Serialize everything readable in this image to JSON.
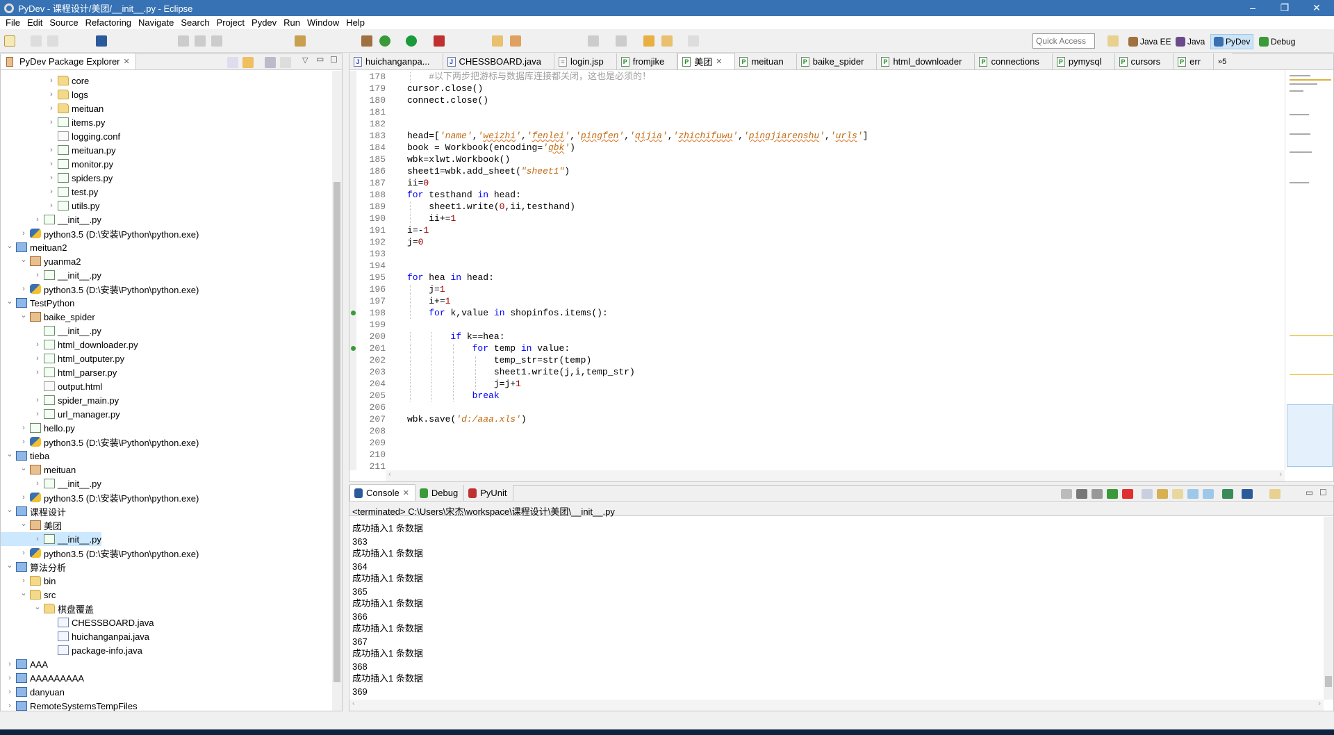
{
  "window": {
    "title": "PyDev - 课程设计/美团/__init__.py - Eclipse",
    "minimize": "–",
    "restore": "❐",
    "close": "✕"
  },
  "menu": [
    "File",
    "Edit",
    "Source",
    "Refactoring",
    "Navigate",
    "Search",
    "Project",
    "Pydev",
    "Run",
    "Window",
    "Help"
  ],
  "toolbar": {
    "quick_access_placeholder": "Quick Access",
    "perspectives": [
      {
        "label": "Java EE",
        "active": false
      },
      {
        "label": "Java",
        "active": false
      },
      {
        "label": "PyDev",
        "active": true
      },
      {
        "label": "Debug",
        "active": false
      }
    ]
  },
  "explorer": {
    "title": "PyDev Package Explorer",
    "items": [
      {
        "label": "core",
        "depth": 3,
        "arrow": ">",
        "icon": "folder"
      },
      {
        "label": "logs",
        "depth": 3,
        "arrow": ">",
        "icon": "folder"
      },
      {
        "label": "meituan",
        "depth": 3,
        "arrow": ">",
        "icon": "folder"
      },
      {
        "label": "items.py",
        "depth": 3,
        "arrow": ">",
        "icon": "pyfile"
      },
      {
        "label": "logging.conf",
        "depth": 3,
        "arrow": "",
        "icon": "txtfile"
      },
      {
        "label": "meituan.py",
        "depth": 3,
        "arrow": ">",
        "icon": "pyfile"
      },
      {
        "label": "monitor.py",
        "depth": 3,
        "arrow": ">",
        "icon": "pyfile"
      },
      {
        "label": "spiders.py",
        "depth": 3,
        "arrow": ">",
        "icon": "pyfile"
      },
      {
        "label": "test.py",
        "depth": 3,
        "arrow": ">",
        "icon": "pyfile"
      },
      {
        "label": "utils.py",
        "depth": 3,
        "arrow": ">",
        "icon": "pyfile"
      },
      {
        "label": "__init__.py",
        "depth": 2,
        "arrow": ">",
        "icon": "pyfile"
      },
      {
        "label": "python3.5  (D:\\安装\\Python\\python.exe)",
        "depth": 1,
        "arrow": ">",
        "icon": "python"
      },
      {
        "label": "meituan2",
        "depth": 0,
        "arrow": "v",
        "icon": "project"
      },
      {
        "label": "yuanma2",
        "depth": 1,
        "arrow": "v",
        "icon": "package"
      },
      {
        "label": "__init__.py",
        "depth": 2,
        "arrow": ">",
        "icon": "pyfile"
      },
      {
        "label": "python3.5  (D:\\安装\\Python\\python.exe)",
        "depth": 1,
        "arrow": ">",
        "icon": "python"
      },
      {
        "label": "TestPython",
        "depth": 0,
        "arrow": "v",
        "icon": "project"
      },
      {
        "label": "baike_spider",
        "depth": 1,
        "arrow": "v",
        "icon": "package"
      },
      {
        "label": "__init__.py",
        "depth": 2,
        "arrow": "",
        "icon": "pyfile"
      },
      {
        "label": "html_downloader.py",
        "depth": 2,
        "arrow": ">",
        "icon": "pyfile"
      },
      {
        "label": "html_outputer.py",
        "depth": 2,
        "arrow": ">",
        "icon": "pyfile"
      },
      {
        "label": "html_parser.py",
        "depth": 2,
        "arrow": ">",
        "icon": "pyfile"
      },
      {
        "label": "output.html",
        "depth": 2,
        "arrow": "",
        "icon": "txtfile"
      },
      {
        "label": "spider_main.py",
        "depth": 2,
        "arrow": ">",
        "icon": "pyfile"
      },
      {
        "label": "url_manager.py",
        "depth": 2,
        "arrow": ">",
        "icon": "pyfile"
      },
      {
        "label": "hello.py",
        "depth": 1,
        "arrow": ">",
        "icon": "pyfile"
      },
      {
        "label": "python3.5  (D:\\安装\\Python\\python.exe)",
        "depth": 1,
        "arrow": ">",
        "icon": "python"
      },
      {
        "label": "tieba",
        "depth": 0,
        "arrow": "v",
        "icon": "project"
      },
      {
        "label": "meituan",
        "depth": 1,
        "arrow": "v",
        "icon": "package"
      },
      {
        "label": "__init__.py",
        "depth": 2,
        "arrow": ">",
        "icon": "pyfile"
      },
      {
        "label": "python3.5  (D:\\安装\\Python\\python.exe)",
        "depth": 1,
        "arrow": ">",
        "icon": "python"
      },
      {
        "label": "课程设计",
        "depth": 0,
        "arrow": "v",
        "icon": "project"
      },
      {
        "label": "美团",
        "depth": 1,
        "arrow": "v",
        "icon": "package"
      },
      {
        "label": "__init__.py",
        "depth": 2,
        "arrow": ">",
        "icon": "pyfile",
        "selected": true
      },
      {
        "label": "python3.5  (D:\\安装\\Python\\python.exe)",
        "depth": 1,
        "arrow": ">",
        "icon": "python"
      },
      {
        "label": "算法分析",
        "depth": 0,
        "arrow": "v",
        "icon": "project"
      },
      {
        "label": "bin",
        "depth": 1,
        "arrow": ">",
        "icon": "folder"
      },
      {
        "label": "src",
        "depth": 1,
        "arrow": "v",
        "icon": "folder"
      },
      {
        "label": "棋盘覆盖",
        "depth": 2,
        "arrow": "v",
        "icon": "folder"
      },
      {
        "label": "CHESSBOARD.java",
        "depth": 3,
        "arrow": "",
        "icon": "java"
      },
      {
        "label": "huichanganpai.java",
        "depth": 3,
        "arrow": "",
        "icon": "java"
      },
      {
        "label": "package-info.java",
        "depth": 3,
        "arrow": "",
        "icon": "java"
      },
      {
        "label": "AAA",
        "depth": 0,
        "arrow": ">",
        "icon": "project"
      },
      {
        "label": "AAAAAAAAA",
        "depth": 0,
        "arrow": ">",
        "icon": "project"
      },
      {
        "label": "danyuan",
        "depth": 0,
        "arrow": ">",
        "icon": "project"
      },
      {
        "label": "RemoteSystemsTempFiles",
        "depth": 0,
        "arrow": ">",
        "icon": "project"
      }
    ]
  },
  "editor": {
    "tabs": [
      {
        "label": "huichanganpa...",
        "icon": "java"
      },
      {
        "label": "CHESSBOARD.java",
        "icon": "java"
      },
      {
        "label": "login.jsp",
        "icon": "doc"
      },
      {
        "label": "fromjike",
        "icon": "py"
      },
      {
        "label": "美团",
        "icon": "py",
        "active": true
      },
      {
        "label": "meituan",
        "icon": "py"
      },
      {
        "label": "baike_spider",
        "icon": "py"
      },
      {
        "label": "html_downloader",
        "icon": "py"
      },
      {
        "label": "connections",
        "icon": "py"
      },
      {
        "label": "pymysql",
        "icon": "py"
      },
      {
        "label": "cursors",
        "icon": "py"
      },
      {
        "label": "err",
        "icon": "py"
      }
    ],
    "overflow": "»5",
    "lines": [
      {
        "n": 178,
        "code": "    #以下两步把游标与数据库连接都关闭，这也是必须的！"
      },
      {
        "n": 179,
        "code": "cursor.close()"
      },
      {
        "n": 180,
        "code": "connect.close()"
      },
      {
        "n": 181,
        "code": ""
      },
      {
        "n": 182,
        "code": ""
      },
      {
        "n": 183,
        "code": "head=['name','weizhi','fenlei','pingfen','qijia','zhichifuwu','pingjiarenshu','urls']"
      },
      {
        "n": 184,
        "code": "book = Workbook(encoding='gbk')"
      },
      {
        "n": 185,
        "code": "wbk=xlwt.Workbook()"
      },
      {
        "n": 186,
        "code": "sheet1=wbk.add_sheet(\"sheet1\")"
      },
      {
        "n": 187,
        "code": "ii=0"
      },
      {
        "n": 188,
        "code": "for testhand in head:"
      },
      {
        "n": 189,
        "code": "    sheet1.write(0,ii,testhand)"
      },
      {
        "n": 190,
        "code": "    ii+=1"
      },
      {
        "n": 191,
        "code": "i=-1"
      },
      {
        "n": 192,
        "code": "j=0"
      },
      {
        "n": 193,
        "code": ""
      },
      {
        "n": 194,
        "code": ""
      },
      {
        "n": 195,
        "code": "for hea in head:"
      },
      {
        "n": 196,
        "code": "    j=1"
      },
      {
        "n": 197,
        "code": "    i+=1"
      },
      {
        "n": 198,
        "code": "    for k,value in shopinfos.items():",
        "breakpoint": true
      },
      {
        "n": 199,
        "code": ""
      },
      {
        "n": 200,
        "code": "        if k==hea:"
      },
      {
        "n": 201,
        "code": "            for temp in value:",
        "breakpoint": true
      },
      {
        "n": 202,
        "code": "                temp_str=str(temp)"
      },
      {
        "n": 203,
        "code": "                sheet1.write(j,i,temp_str)"
      },
      {
        "n": 204,
        "code": "                j=j+1"
      },
      {
        "n": 205,
        "code": "            break"
      },
      {
        "n": 206,
        "code": ""
      },
      {
        "n": 207,
        "code": "wbk.save('d:/aaa.xls')"
      },
      {
        "n": 208,
        "code": ""
      },
      {
        "n": 209,
        "code": ""
      },
      {
        "n": 210,
        "code": ""
      },
      {
        "n": 211,
        "code": ""
      }
    ]
  },
  "console": {
    "tabs": [
      {
        "label": "Console",
        "active": true
      },
      {
        "label": "Debug"
      },
      {
        "label": "PyUnit"
      }
    ],
    "header": "<terminated> C:\\Users\\宋杰\\workspace\\课程设计\\美团\\__init__.py",
    "lines": [
      "成功插入1 条数据",
      "363",
      "成功插入1 条数据",
      "364",
      "成功插入1 条数据",
      "365",
      "成功插入1 条数据",
      "366",
      "成功插入1 条数据",
      "367",
      "成功插入1 条数据",
      "368",
      "成功插入1 条数据",
      "369"
    ]
  },
  "colors": {
    "titlebar": "#3773b4",
    "keyword": "#0000ff",
    "string": "#c06a10",
    "number": "#a00000",
    "comment": "#a0a0a0",
    "selection": "#cce8ff"
  }
}
